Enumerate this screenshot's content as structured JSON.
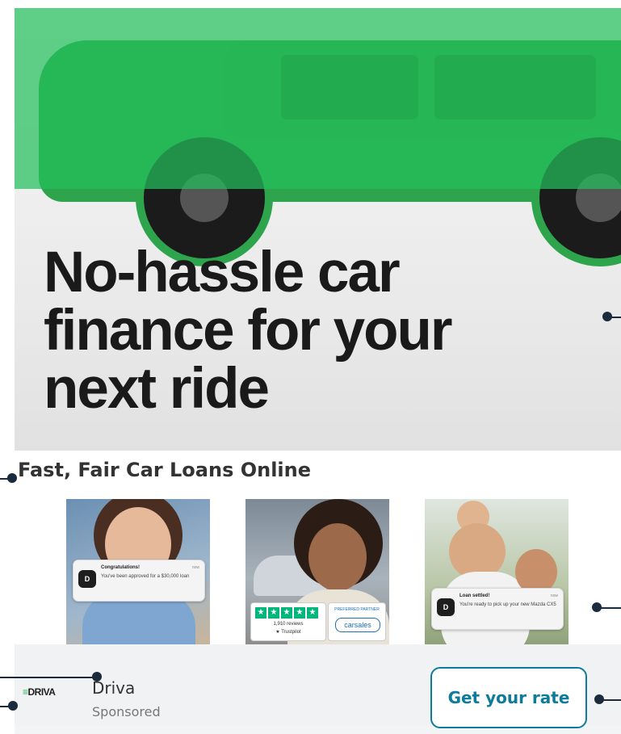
{
  "ad": {
    "headline": "No-hassle car\nfinance for your\nnext ride",
    "subheading": "Fast, Fair Car Loans Online",
    "advertiser": "Driva",
    "advertiser_logo_text": "DRIVA",
    "sponsored_label": "Sponsored",
    "cta_label": "Get your rate"
  },
  "thumbnails": [
    {
      "notification": {
        "title": "Congratulations!",
        "time": "now",
        "message": "You've been approved for a $30,000 loan",
        "logo": "D"
      }
    },
    {
      "trustpilot": {
        "reviews": "1,910 reviews",
        "brand": "★ Trustpilot"
      },
      "partner": {
        "label": "PREFERRED PARTNER",
        "name": "carsales"
      }
    },
    {
      "notification": {
        "title": "Loan settled!",
        "time": "now",
        "message": "You're ready to pick up your new Mazda CX5",
        "logo": "D"
      }
    }
  ],
  "icons": {
    "truck": "pickup-truck-image",
    "trustpilot_star": "star-icon"
  },
  "colors": {
    "overlay_green": "#24be5a",
    "cta_accent": "#0d7b9b",
    "trustpilot_green": "#00b67a",
    "callout": "#1b2a3d"
  }
}
